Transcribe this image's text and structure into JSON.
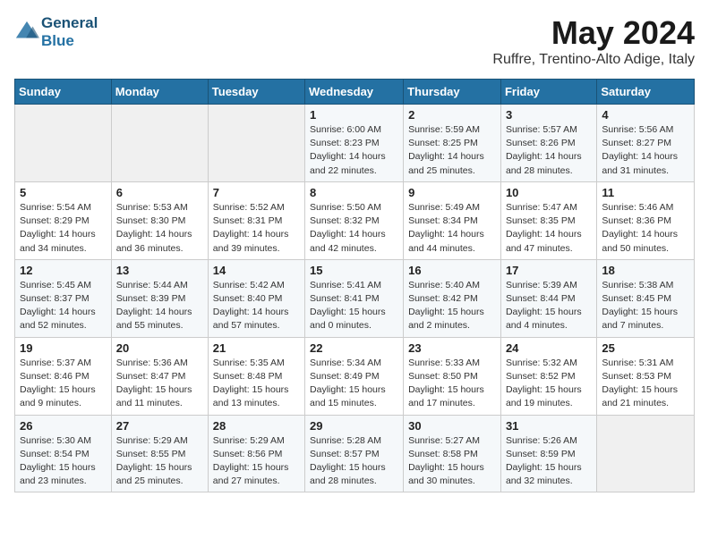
{
  "header": {
    "logo_line1": "General",
    "logo_line2": "Blue",
    "month": "May 2024",
    "location": "Ruffre, Trentino-Alto Adige, Italy"
  },
  "columns": [
    "Sunday",
    "Monday",
    "Tuesday",
    "Wednesday",
    "Thursday",
    "Friday",
    "Saturday"
  ],
  "weeks": [
    [
      {
        "day": "",
        "content": ""
      },
      {
        "day": "",
        "content": ""
      },
      {
        "day": "",
        "content": ""
      },
      {
        "day": "1",
        "content": "Sunrise: 6:00 AM\nSunset: 8:23 PM\nDaylight: 14 hours\nand 22 minutes."
      },
      {
        "day": "2",
        "content": "Sunrise: 5:59 AM\nSunset: 8:25 PM\nDaylight: 14 hours\nand 25 minutes."
      },
      {
        "day": "3",
        "content": "Sunrise: 5:57 AM\nSunset: 8:26 PM\nDaylight: 14 hours\nand 28 minutes."
      },
      {
        "day": "4",
        "content": "Sunrise: 5:56 AM\nSunset: 8:27 PM\nDaylight: 14 hours\nand 31 minutes."
      }
    ],
    [
      {
        "day": "5",
        "content": "Sunrise: 5:54 AM\nSunset: 8:29 PM\nDaylight: 14 hours\nand 34 minutes."
      },
      {
        "day": "6",
        "content": "Sunrise: 5:53 AM\nSunset: 8:30 PM\nDaylight: 14 hours\nand 36 minutes."
      },
      {
        "day": "7",
        "content": "Sunrise: 5:52 AM\nSunset: 8:31 PM\nDaylight: 14 hours\nand 39 minutes."
      },
      {
        "day": "8",
        "content": "Sunrise: 5:50 AM\nSunset: 8:32 PM\nDaylight: 14 hours\nand 42 minutes."
      },
      {
        "day": "9",
        "content": "Sunrise: 5:49 AM\nSunset: 8:34 PM\nDaylight: 14 hours\nand 44 minutes."
      },
      {
        "day": "10",
        "content": "Sunrise: 5:47 AM\nSunset: 8:35 PM\nDaylight: 14 hours\nand 47 minutes."
      },
      {
        "day": "11",
        "content": "Sunrise: 5:46 AM\nSunset: 8:36 PM\nDaylight: 14 hours\nand 50 minutes."
      }
    ],
    [
      {
        "day": "12",
        "content": "Sunrise: 5:45 AM\nSunset: 8:37 PM\nDaylight: 14 hours\nand 52 minutes."
      },
      {
        "day": "13",
        "content": "Sunrise: 5:44 AM\nSunset: 8:39 PM\nDaylight: 14 hours\nand 55 minutes."
      },
      {
        "day": "14",
        "content": "Sunrise: 5:42 AM\nSunset: 8:40 PM\nDaylight: 14 hours\nand 57 minutes."
      },
      {
        "day": "15",
        "content": "Sunrise: 5:41 AM\nSunset: 8:41 PM\nDaylight: 15 hours\nand 0 minutes."
      },
      {
        "day": "16",
        "content": "Sunrise: 5:40 AM\nSunset: 8:42 PM\nDaylight: 15 hours\nand 2 minutes."
      },
      {
        "day": "17",
        "content": "Sunrise: 5:39 AM\nSunset: 8:44 PM\nDaylight: 15 hours\nand 4 minutes."
      },
      {
        "day": "18",
        "content": "Sunrise: 5:38 AM\nSunset: 8:45 PM\nDaylight: 15 hours\nand 7 minutes."
      }
    ],
    [
      {
        "day": "19",
        "content": "Sunrise: 5:37 AM\nSunset: 8:46 PM\nDaylight: 15 hours\nand 9 minutes."
      },
      {
        "day": "20",
        "content": "Sunrise: 5:36 AM\nSunset: 8:47 PM\nDaylight: 15 hours\nand 11 minutes."
      },
      {
        "day": "21",
        "content": "Sunrise: 5:35 AM\nSunset: 8:48 PM\nDaylight: 15 hours\nand 13 minutes."
      },
      {
        "day": "22",
        "content": "Sunrise: 5:34 AM\nSunset: 8:49 PM\nDaylight: 15 hours\nand 15 minutes."
      },
      {
        "day": "23",
        "content": "Sunrise: 5:33 AM\nSunset: 8:50 PM\nDaylight: 15 hours\nand 17 minutes."
      },
      {
        "day": "24",
        "content": "Sunrise: 5:32 AM\nSunset: 8:52 PM\nDaylight: 15 hours\nand 19 minutes."
      },
      {
        "day": "25",
        "content": "Sunrise: 5:31 AM\nSunset: 8:53 PM\nDaylight: 15 hours\nand 21 minutes."
      }
    ],
    [
      {
        "day": "26",
        "content": "Sunrise: 5:30 AM\nSunset: 8:54 PM\nDaylight: 15 hours\nand 23 minutes."
      },
      {
        "day": "27",
        "content": "Sunrise: 5:29 AM\nSunset: 8:55 PM\nDaylight: 15 hours\nand 25 minutes."
      },
      {
        "day": "28",
        "content": "Sunrise: 5:29 AM\nSunset: 8:56 PM\nDaylight: 15 hours\nand 27 minutes."
      },
      {
        "day": "29",
        "content": "Sunrise: 5:28 AM\nSunset: 8:57 PM\nDaylight: 15 hours\nand 28 minutes."
      },
      {
        "day": "30",
        "content": "Sunrise: 5:27 AM\nSunset: 8:58 PM\nDaylight: 15 hours\nand 30 minutes."
      },
      {
        "day": "31",
        "content": "Sunrise: 5:26 AM\nSunset: 8:59 PM\nDaylight: 15 hours\nand 32 minutes."
      },
      {
        "day": "",
        "content": ""
      }
    ]
  ]
}
